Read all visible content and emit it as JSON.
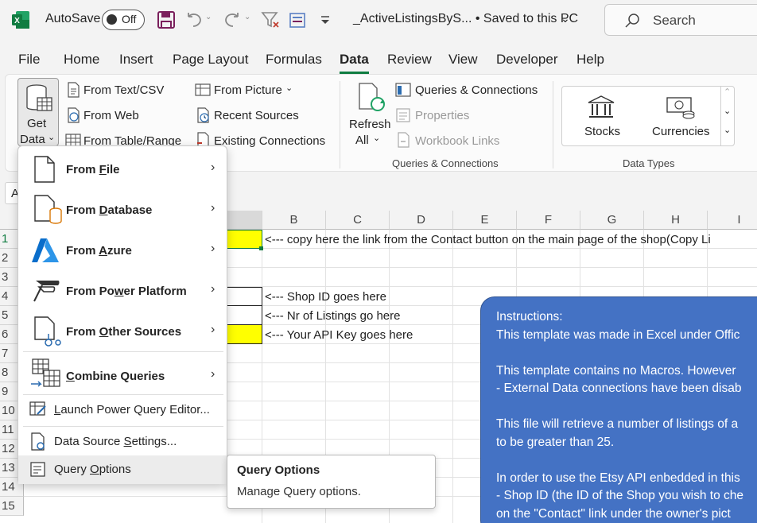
{
  "titlebar": {
    "autosave_label": "AutoSave",
    "autosave_state": "Off",
    "document_title": "_ActiveListingsByS...  •  Saved to this PC",
    "search_placeholder": "Search"
  },
  "tabs": [
    "File",
    "Home",
    "Insert",
    "Page Layout",
    "Formulas",
    "Data",
    "Review",
    "View",
    "Developer",
    "Help"
  ],
  "active_tab": "Data",
  "ribbon": {
    "get_data_line1": "Get",
    "get_data_line2": "Data",
    "from_text_csv": "From Text/CSV",
    "from_web": "From Web",
    "from_table_range": "From Table/Range",
    "from_picture": "From Picture",
    "recent_sources": "Recent Sources",
    "existing_connections": "Existing Connections",
    "refresh_line1": "Refresh",
    "refresh_line2": "All",
    "queries_connections": "Queries & Connections",
    "properties": "Properties",
    "workbook_links": "Workbook Links",
    "group_queries": "Queries & Connections",
    "stocks": "Stocks",
    "currencies": "Currencies",
    "group_data_types": "Data Types"
  },
  "namebox": "A",
  "columns": [
    "B",
    "C",
    "D",
    "E",
    "F",
    "G",
    "H",
    "I"
  ],
  "rows": [
    "1",
    "2",
    "3",
    "4",
    "5",
    "6",
    "7",
    "8",
    "9",
    "10",
    "11",
    "12",
    "13",
    "14",
    "15"
  ],
  "cells": {
    "b1": "<--- copy here the link from the Contact button on the main page of the shop(Copy Li",
    "b4": "<--- Shop ID goes here",
    "b5": "<--- Nr of Listings go here",
    "b6": "<--- Your API Key goes here"
  },
  "instructions": [
    "Instructions:",
    "This template was made in Excel under Offic",
    "",
    "This template contains no Macros. However",
    " - External Data connections have been disab",
    "",
    "This file will retrieve a number of listings of a",
    "to be greater than 25.",
    "",
    "In order to use the Etsy API enbedded in this",
    "- Shop ID (the ID of the Shop you wish to che",
    "on the \"Contact\" link under the owner's pict"
  ],
  "menu": {
    "from_file": {
      "pre": "From ",
      "acc": "F",
      "post": "ile"
    },
    "from_database": {
      "pre": "From ",
      "acc": "D",
      "post": "atabase"
    },
    "from_azure": {
      "pre": "From ",
      "acc": "A",
      "post": "zure"
    },
    "from_power_platform": {
      "pre": "From Po",
      "acc": "w",
      "post": "er Platform"
    },
    "from_other_sources": {
      "pre": "From ",
      "acc": "O",
      "post": "ther Sources"
    },
    "combine_queries": {
      "pre": "",
      "acc": "C",
      "post": "ombine Queries"
    },
    "launch_pq_editor": {
      "pre": "",
      "acc": "L",
      "post": "aunch Power Query Editor..."
    },
    "data_source_settings": {
      "pre": "Data Source ",
      "acc": "S",
      "post": "ettings..."
    },
    "query_options": {
      "pre": "Query ",
      "acc": "O",
      "post": "ptions"
    }
  },
  "tooltip": {
    "title": "Query Options",
    "description": "Manage Query options."
  },
  "colors": {
    "excel_green": "#107c41",
    "highlight_yellow": "#ffff00",
    "shape_blue": "#4472c4"
  }
}
